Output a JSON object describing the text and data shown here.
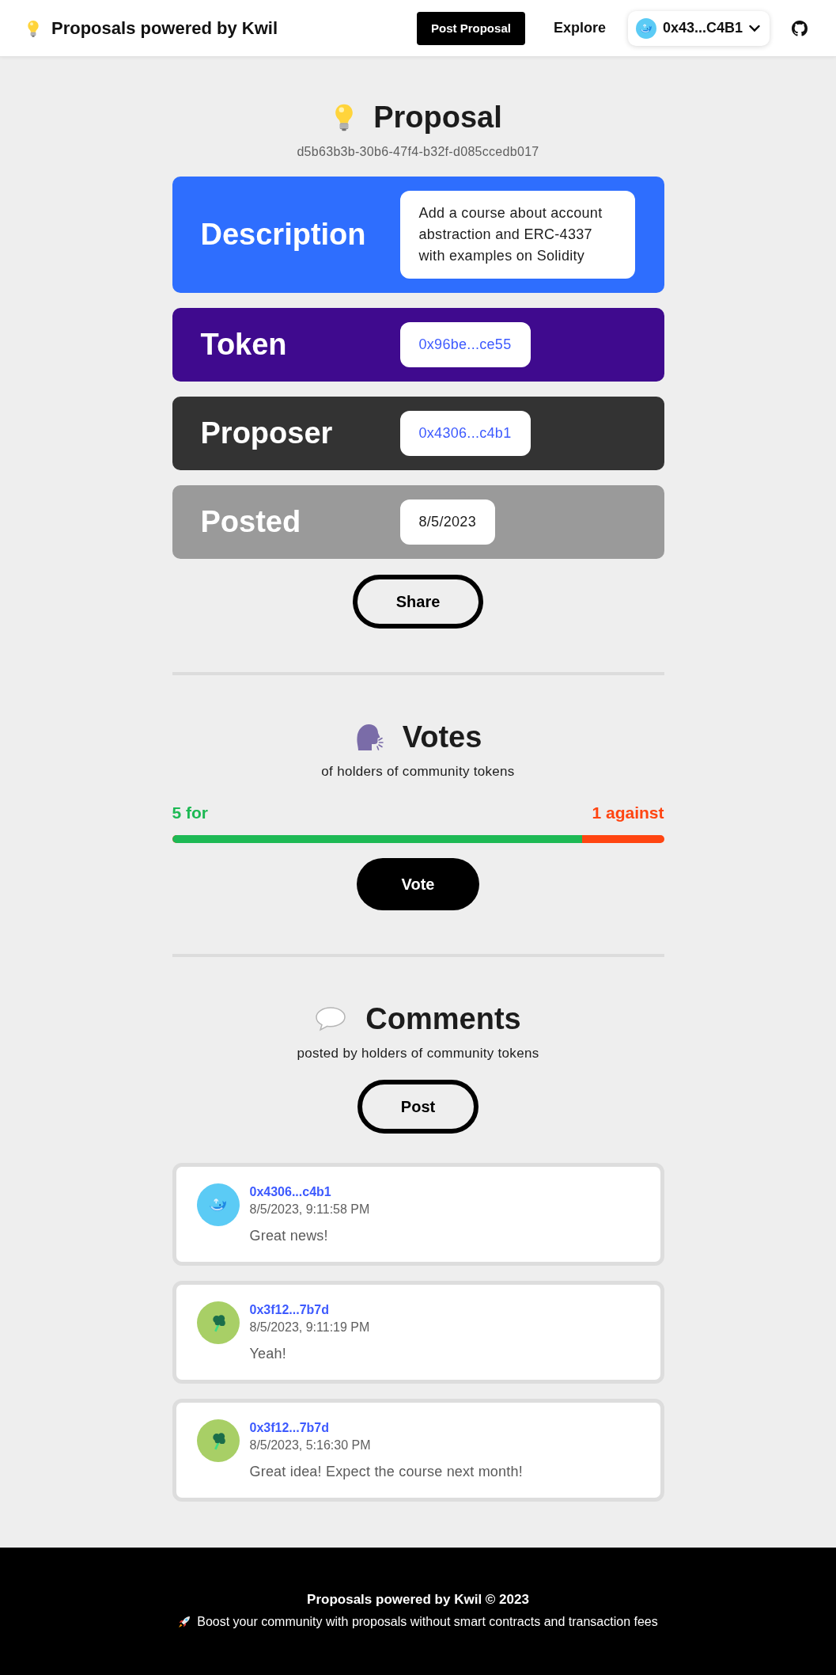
{
  "header": {
    "title": "Proposals powered by Kwil",
    "post_button": "Post Proposal",
    "explore_link": "Explore",
    "wallet": {
      "address": "0x43...C4B1"
    }
  },
  "proposal": {
    "title": "Proposal",
    "id": "d5b63b3b-30b6-47f4-b32f-d085ccedb017",
    "fields": [
      {
        "kind": "text",
        "label": "Description",
        "value": "Add a course about account abstraction and ERC-4337 with examples on Solidity",
        "color": "#2e6efe"
      },
      {
        "kind": "link",
        "label": "Token",
        "value": "0x96be...ce55",
        "color": "#3f0a8e"
      },
      {
        "kind": "link",
        "label": "Proposer",
        "value": "0x4306...c4b1",
        "color": "#333333"
      },
      {
        "kind": "text",
        "label": "Posted",
        "value": "8/5/2023",
        "color": "#9a9a9a"
      }
    ],
    "share_button": "Share"
  },
  "votes": {
    "title": "Votes",
    "subtitle": "of holders of community tokens",
    "for_label": "5 for",
    "against_label": "1 against",
    "level": 0.833,
    "vote_button": "Vote"
  },
  "comments": {
    "title": "Comments",
    "subtitle": "posted by holders of community tokens",
    "post_button": "Post",
    "items": [
      {
        "kind": "whale",
        "color": "#5bcbf5",
        "author": "0x4306...c4b1",
        "time": "8/5/2023, 9:11:58 PM",
        "text": "Great news!"
      },
      {
        "kind": "broccoli",
        "color": "#a8cf66",
        "author": "0x3f12...7b7d",
        "time": "8/5/2023, 9:11:19 PM",
        "text": "Yeah!"
      },
      {
        "kind": "broccoli",
        "color": "#a8cf66",
        "author": "0x3f12...7b7d",
        "time": "8/5/2023, 5:16:30 PM",
        "text": "Great idea! Expect the course next month!"
      }
    ]
  },
  "footer": {
    "title": "Proposals powered by Kwil © 2023",
    "tagline": "Boost your community with proposals without smart contracts and transaction fees"
  }
}
